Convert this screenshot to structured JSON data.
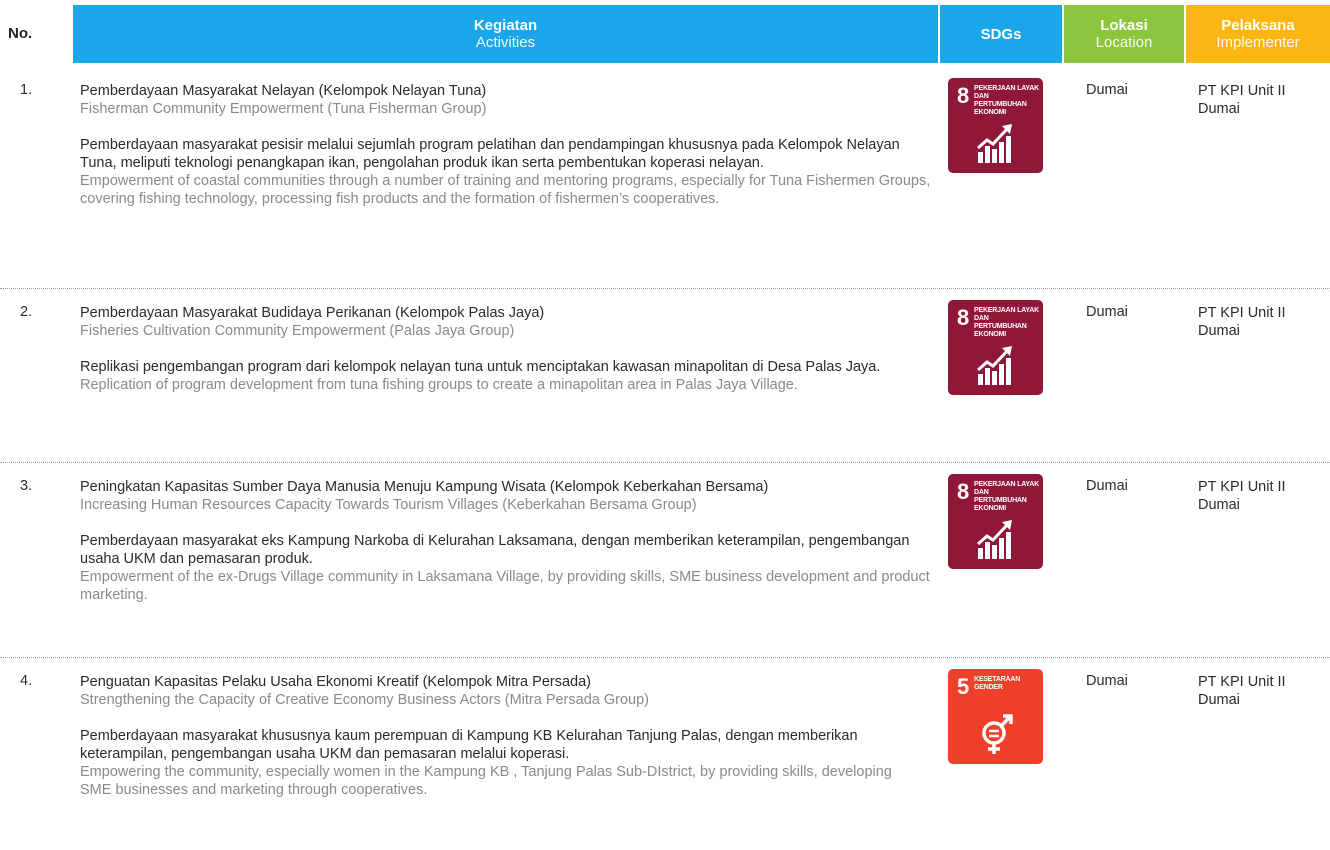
{
  "header": {
    "no": "No.",
    "activities_id": "Kegiatan",
    "activities_en": "Activities",
    "sdgs": "SDGs",
    "location_id": "Lokasi",
    "location_en": "Location",
    "implementer_id": "Pelaksana",
    "implementer_en": "Implementer"
  },
  "colors": {
    "header_blue": "#1aa6e8",
    "header_green": "#8cc63f",
    "header_yellow": "#fbb614",
    "sdg8": "#8f1838",
    "sdg5": "#ef402b"
  },
  "rows": [
    {
      "no": "1.",
      "title_id": "Pemberdayaan Masyarakat Nelayan (Kelompok Nelayan Tuna)",
      "title_en": "Fisherman Community Empowerment (Tuna Fisherman Group)",
      "desc_id": "Pemberdayaan masyarakat pesisir melalui sejumlah program pelatihan dan pendampingan khususnya pada Kelompok Nelayan Tuna, meliputi teknologi penangkapan ikan, pengolahan produk ikan serta pembentukan koperasi nelayan.",
      "desc_en": "Empowerment of coastal communities through a number of training and mentoring programs, especially for Tuna Fishermen Groups, covering fishing technology, processing fish products and the formation of fishermen’s cooperatives.",
      "sdg_number": "8",
      "sdg_label": "PEKERJAAN LAYAK DAN PERTUMBUHAN EKONOMI",
      "sdg_icon": "growth-chart-icon",
      "location": "Dumai",
      "implementer": "PT KPI Unit II Dumai"
    },
    {
      "no": "2.",
      "title_id": "Pemberdayaan Masyarakat Budidaya Perikanan (Kelompok Palas Jaya)",
      "title_en": "Fisheries Cultivation Community Empowerment (Palas Jaya Group)",
      "desc_id": "Replikasi pengembangan program dari kelompok nelayan tuna untuk menciptakan kawasan minapolitan di Desa Palas Jaya.",
      "desc_en": "Replication of program development from tuna fishing groups to create a minapolitan area in Palas Jaya Village.",
      "sdg_number": "8",
      "sdg_label": "PEKERJAAN LAYAK DAN PERTUMBUHAN EKONOMI",
      "sdg_icon": "growth-chart-icon",
      "location": "Dumai",
      "implementer": "PT KPI Unit II Dumai"
    },
    {
      "no": "3.",
      "title_id": "Peningkatan Kapasitas Sumber Daya Manusia Menuju Kampung Wisata (Kelompok Keberkahan Bersama)",
      "title_en": "Increasing Human Resources Capacity Towards Tourism Villages (Keberkahan Bersama Group)",
      "desc_id": "Pemberdayaan masyarakat eks Kampung Narkoba di Kelurahan Laksamana, dengan memberikan keterampilan, pengembangan usaha UKM dan pemasaran produk.",
      "desc_en": "Empowerment of the ex-Drugs Village community in Laksamana Village, by providing skills, SME business development and product marketing.",
      "sdg_number": "8",
      "sdg_label": "PEKERJAAN LAYAK DAN PERTUMBUHAN EKONOMI",
      "sdg_icon": "growth-chart-icon",
      "location": "Dumai",
      "implementer": "PT KPI Unit II Dumai"
    },
    {
      "no": "4.",
      "title_id": "Penguatan Kapasitas Pelaku Usaha Ekonomi Kreatif (Kelompok Mitra Persada)",
      "title_en": "Strengthening the Capacity of Creative Economy Business Actors (Mitra Persada Group)",
      "desc_id": "Pemberdayaan masyarakat khususnya kaum perempuan di Kampung KB Kelurahan Tanjung Palas, dengan memberikan keterampilan, pengembangan usaha UKM dan pemasaran melalui koperasi.",
      "desc_en": "Empowering the community, especially women in the Kampung KB , Tanjung Palas Sub-DIstrict, by providing skills, developing SME businesses and marketing through cooperatives.",
      "sdg_number": "5",
      "sdg_label": "KESETARAAN GENDER",
      "sdg_icon": "gender-equality-icon",
      "location": "Dumai",
      "implementer": "PT KPI Unit II Dumai"
    }
  ]
}
